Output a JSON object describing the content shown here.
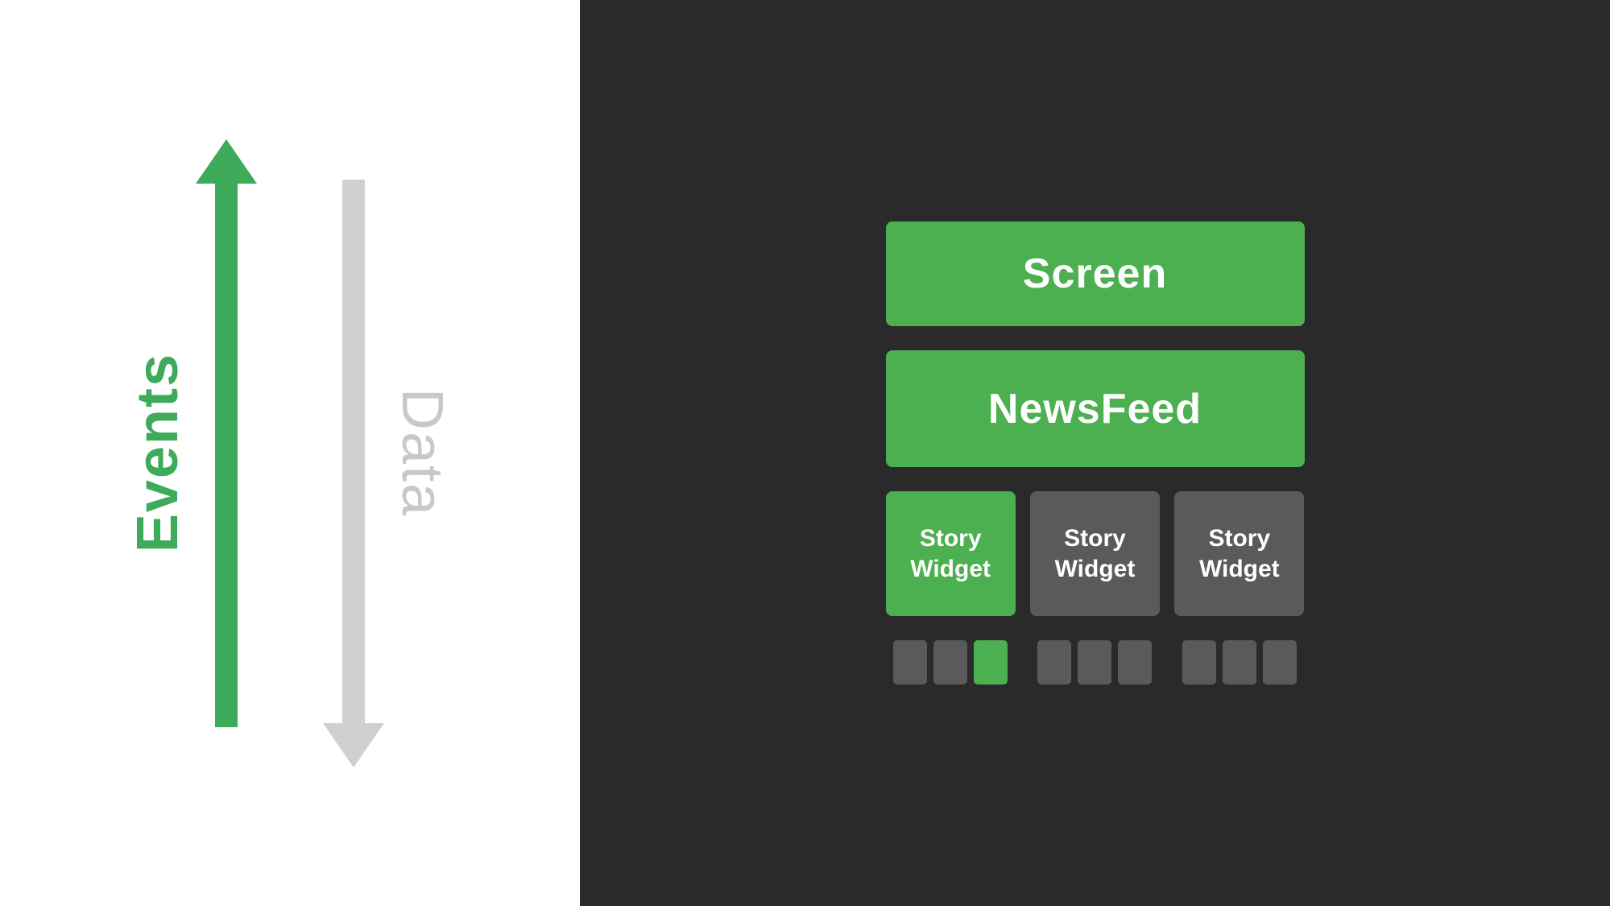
{
  "left_panel": {
    "events_label": "Events",
    "data_label": "Data",
    "bg_color": "#ffffff"
  },
  "right_panel": {
    "bg_color": "#2a2a2a",
    "screen": {
      "label": "Screen"
    },
    "newsfeed": {
      "label": "NewsFeed"
    },
    "story_widgets": [
      {
        "label": "Story\nWidget",
        "variant": "green"
      },
      {
        "label": "Story\nWidget",
        "variant": "gray"
      },
      {
        "label": "Story\nWidget",
        "variant": "gray"
      }
    ],
    "small_block_groups": [
      {
        "blocks": [
          "gray",
          "gray",
          "green"
        ]
      },
      {
        "blocks": [
          "gray",
          "gray",
          "gray"
        ]
      },
      {
        "blocks": [
          "gray",
          "gray",
          "gray"
        ]
      }
    ]
  }
}
